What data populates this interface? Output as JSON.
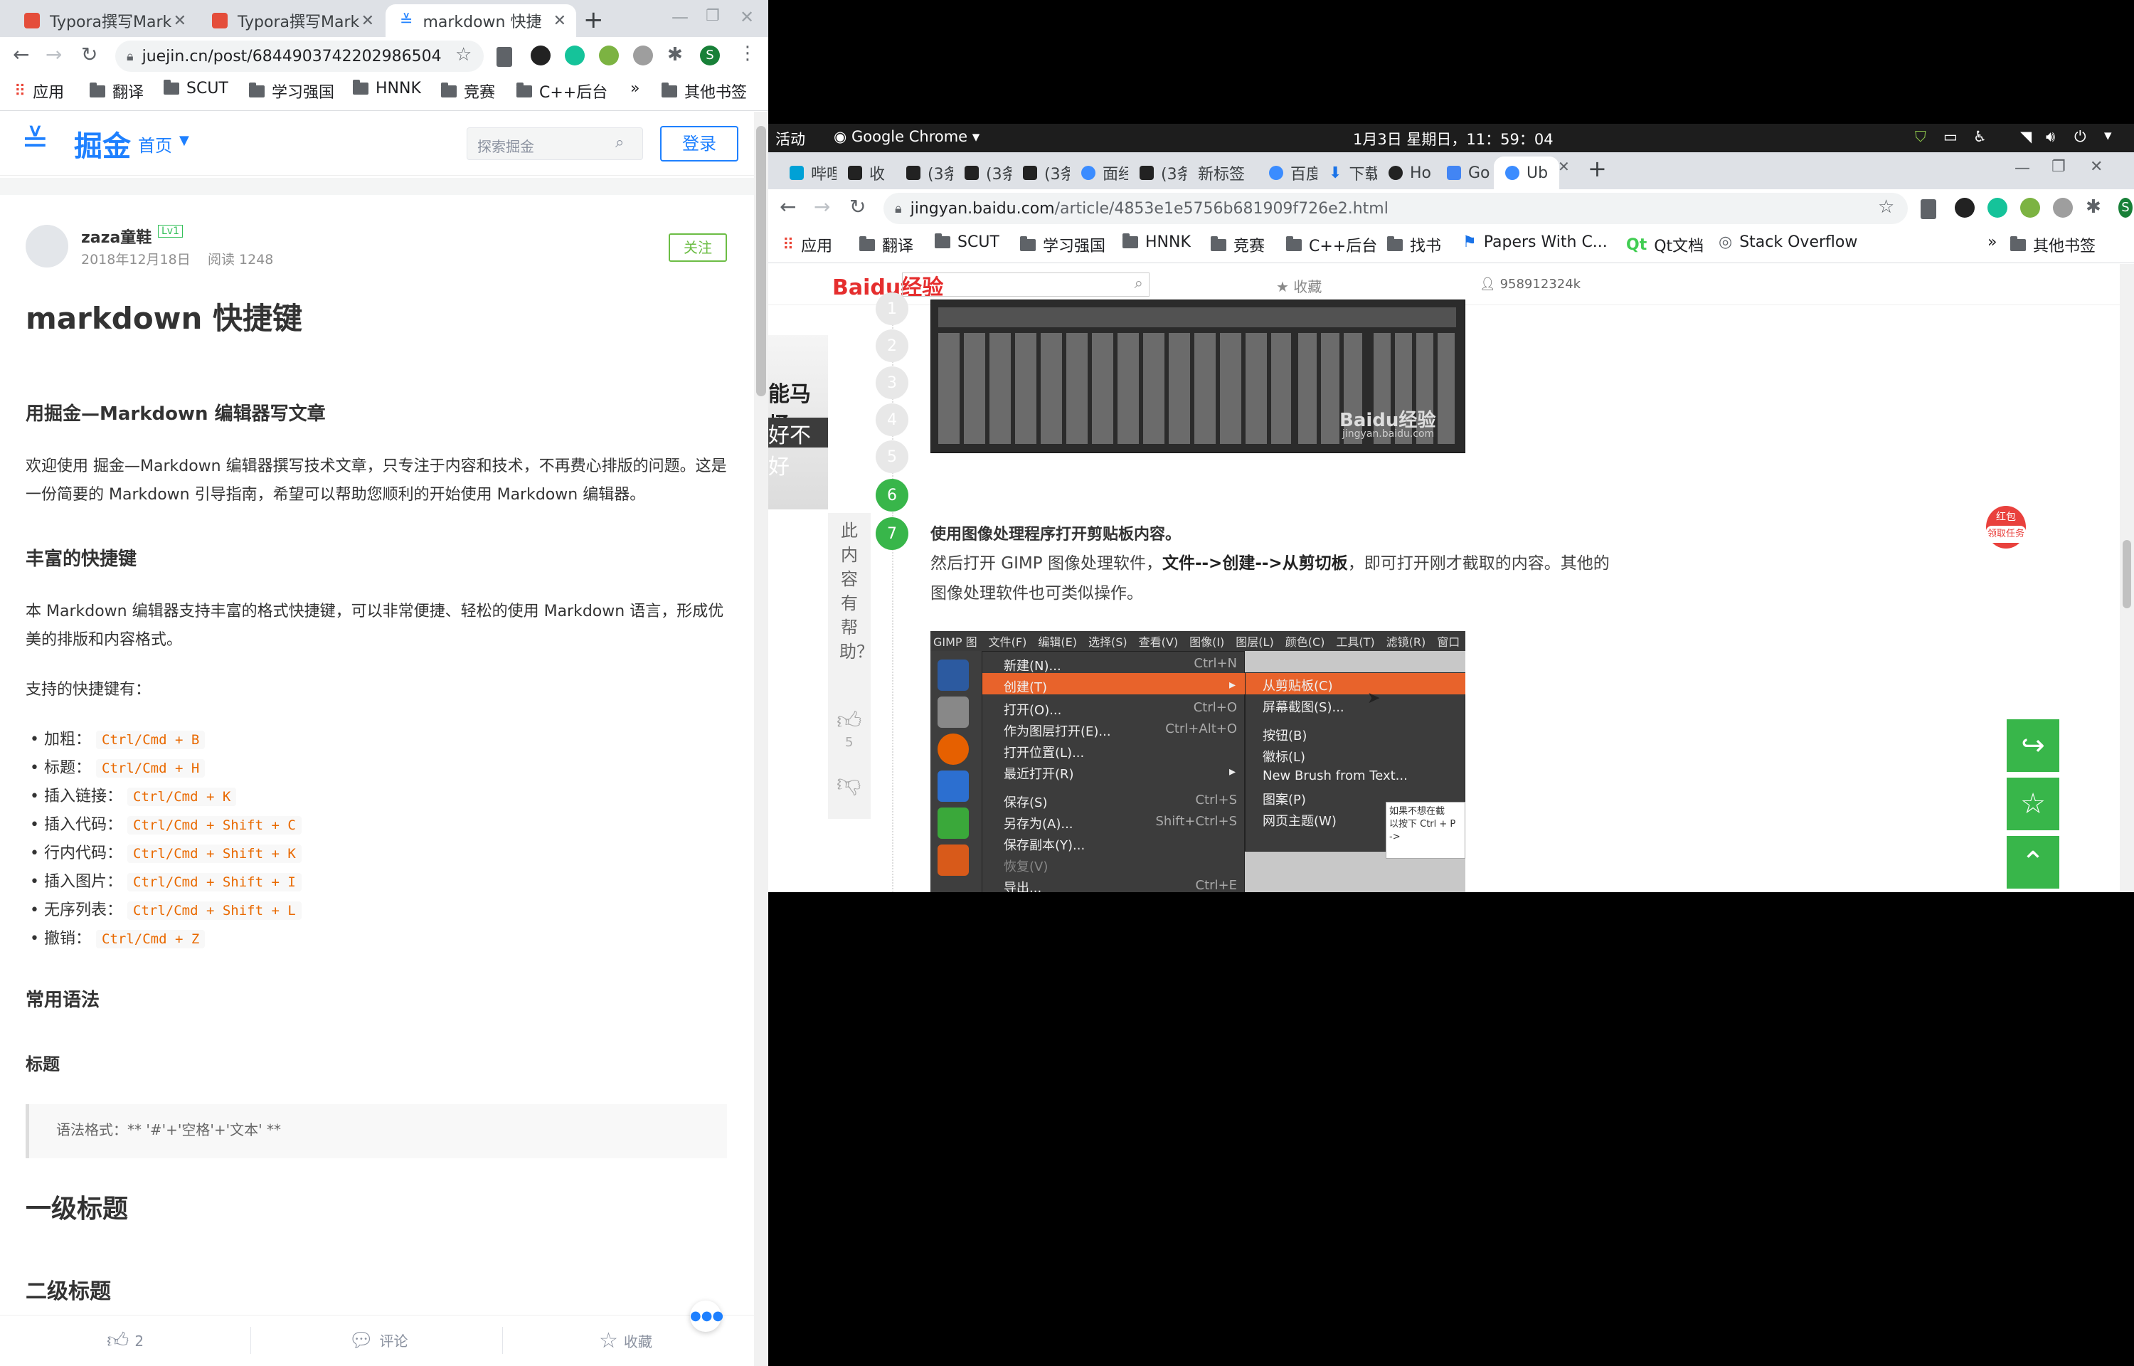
{
  "left_browser": {
    "tabs": [
      {
        "title": "Typora撰写Mark",
        "favicon_color": "#e44d3a"
      },
      {
        "title": "Typora撰写Mark",
        "favicon_color": "#e44d3a"
      },
      {
        "title": "markdown 快捷",
        "favicon_color": "#1e80ff",
        "active": true
      }
    ],
    "new_tab": "+",
    "url": "juejin.cn/post/6844903742202986504",
    "bookmarks": [
      "应用",
      "翻译",
      "SCUT",
      "学习强国",
      "HNNK",
      "竞赛",
      "C++后台",
      "»",
      "其他书签"
    ],
    "profile_initial": "S"
  },
  "juejin": {
    "logo": "掘金",
    "nav_home": "首页",
    "search_placeholder": "探索掘金",
    "login": "登录",
    "author": {
      "name": "zaza童鞋",
      "level": "Lv1",
      "date": "2018年12月18日",
      "reads": "阅读 1248",
      "follow": "关注"
    },
    "title": "markdown 快捷键",
    "section1": "用掘金—Markdown 编辑器写文章",
    "para1": "欢迎使用 掘金—Markdown 编辑器撰写技术文章，只专注于内容和技术，不再费心排版的问题。这是一份简要的 Markdown 引导指南，希望可以帮助您顺利的开始使用 Markdown 编辑器。",
    "section2": "丰富的快捷键",
    "para2": "本 Markdown 编辑器支持丰富的格式快捷键，可以非常便捷、轻松的使用 Markdown 语言，形成优美的排版和内容格式。",
    "para3": "支持的快捷键有：",
    "shortcuts": [
      {
        "label": "加粗：",
        "key": "Ctrl/Cmd + B"
      },
      {
        "label": "标题：",
        "key": "Ctrl/Cmd + H"
      },
      {
        "label": "插入链接：",
        "key": "Ctrl/Cmd + K"
      },
      {
        "label": "插入代码：",
        "key": "Ctrl/Cmd + Shift + C"
      },
      {
        "label": "行内代码：",
        "key": "Ctrl/Cmd + Shift + K"
      },
      {
        "label": "插入图片：",
        "key": "Ctrl/Cmd + Shift + I"
      },
      {
        "label": "无序列表：",
        "key": "Ctrl/Cmd + Shift + L"
      },
      {
        "label": "撤销：",
        "key": "Ctrl/Cmd + Z"
      }
    ],
    "section3": "常用语法",
    "section4": "标题",
    "quote": "语法格式：** '#'+'空格'+'文本' **",
    "h1_demo": "一级标题",
    "h2_demo": "二级标题",
    "bottom": {
      "likes": "2",
      "comment": "评论",
      "collect": "收藏"
    }
  },
  "topbar": {
    "activities": "活动",
    "app": "Google Chrome",
    "clock": "1月3日 星期日，11：59：04"
  },
  "right_browser": {
    "tabs": [
      {
        "title": "哔哩",
        "favicon_color": "#00a1d6"
      },
      {
        "title": "收",
        "favicon_color": "#222222"
      },
      {
        "title": "(3条",
        "favicon_color": "#222222"
      },
      {
        "title": "(3条",
        "favicon_color": "#222222"
      },
      {
        "title": "(3条",
        "favicon_color": "#222222"
      },
      {
        "title": "面经",
        "favicon_color": "#3b8cff"
      },
      {
        "title": "(3条",
        "favicon_color": "#222222"
      },
      {
        "title": "新标签",
        "favicon_color": ""
      },
      {
        "title": "百度",
        "favicon_color": "#3b8cff"
      },
      {
        "title": "下载",
        "favicon_color": "#1a73e8"
      },
      {
        "title": "Ho",
        "favicon_color": "#222222"
      },
      {
        "title": "Go",
        "favicon_color": "#4285f4"
      },
      {
        "title": "Ub",
        "favicon_color": "#3b8cff",
        "active": true
      }
    ],
    "url_host": "jingyan.baidu.com",
    "url_path": "/article/4853e1e5756b681909f726e2.html",
    "bookmarks": [
      "应用",
      "翻译",
      "SCUT",
      "学习强国",
      "HNNK",
      "竞赛",
      "C++后台",
      "找书",
      "Papers With C...",
      "Qt文档",
      "Stack Overflow",
      "»",
      "其他书签"
    ],
    "profile_initial": "S"
  },
  "baidu": {
    "logo": "Baidu经验",
    "collect": "收藏",
    "user": "958912324k",
    "steps": [
      "1",
      "2",
      "3",
      "4",
      "5",
      "6",
      "7"
    ],
    "ad_text1": "能马桶",
    "ad_text2": "好不好",
    "helpful": "此内容有帮助？",
    "thumb_count": "5",
    "step7_title": "使用图像处理程序打开剪贴板内容。",
    "step7_text_a": "然后打开 GIMP 图像处理软件，",
    "step7_bold": "文件-->创建-->从剪切板",
    "step7_text_b": "，即可打开刚才截取的内容。其他的图像处理软件也可类似操作。",
    "watermark": "Baidu经验",
    "watermark_url": "jingyan.baidu.com",
    "hongbao": "红包",
    "hongbao_sub": "领取任务",
    "gimp": {
      "menubar": [
        "GIMP 图",
        "文件(F)",
        "编辑(E)",
        "选择(S)",
        "查看(V)",
        "图像(I)",
        "图层(L)",
        "颜色(C)",
        "工具(T)",
        "滤镜(R)",
        "窗口"
      ],
      "file_menu": [
        {
          "label": "新建(N)...",
          "key": "Ctrl+N"
        },
        {
          "label": "创建(T)",
          "key": ""
        },
        {
          "label": "打开(O)...",
          "key": "Ctrl+O"
        },
        {
          "label": "作为图层打开(E)...",
          "key": "Ctrl+Alt+O"
        },
        {
          "label": "打开位置(L)...",
          "key": ""
        },
        {
          "label": "最近打开(R)",
          "key": ""
        },
        {
          "label": "保存(S)",
          "key": "Ctrl+S"
        },
        {
          "label": "另存为(A)...",
          "key": "Shift+Ctrl+S"
        },
        {
          "label": "保存副本(Y)...",
          "key": ""
        },
        {
          "label": "恢复(V)",
          "key": ""
        },
        {
          "label": "导出...",
          "key": "Ctrl+E"
        }
      ],
      "sub_menu": [
        "从剪贴板(C)",
        "屏幕截图(S)...",
        "按钮(B)",
        "徽标(L)",
        "New Brush from Text...",
        "图案(P)",
        "网页主题(W)"
      ],
      "tooltip": [
        "如果不想在截",
        "以按下 Ctrl + P",
        "->"
      ]
    }
  }
}
